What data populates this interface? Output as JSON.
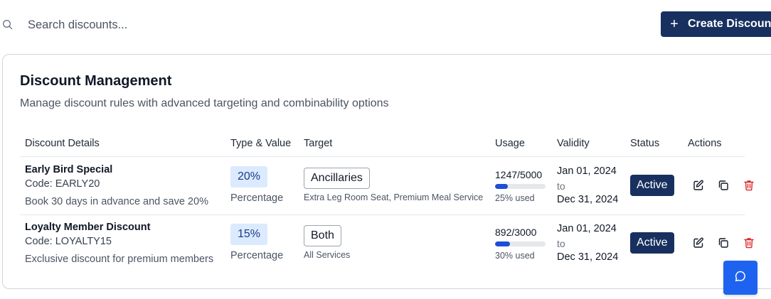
{
  "search": {
    "placeholder": "Search discounts..."
  },
  "create_button": {
    "label": "Create Discount"
  },
  "card": {
    "title": "Discount Management",
    "subtitle": "Manage discount rules with advanced targeting and combinability options"
  },
  "table": {
    "headers": [
      "Discount Details",
      "Type & Value",
      "Target",
      "Usage",
      "Validity",
      "Status",
      "Actions"
    ],
    "rows": [
      {
        "name": "Early Bird Special",
        "code": "Code: EARLY20",
        "description": "Book 30 days in advance and save 20%",
        "value": "20%",
        "type": "Percentage",
        "target": "Ancillaries",
        "target_detail": "Extra Leg Room Seat, Premium Meal Service",
        "usage": "1247/5000",
        "usage_fraction": 0.25,
        "usage_label": "25% used",
        "valid_from": "Jan 01, 2024",
        "valid_to_word": "to",
        "valid_until": "Dec 31, 2024",
        "status": "Active"
      },
      {
        "name": "Loyalty Member Discount",
        "code": "Code: LOYALTY15",
        "description": "Exclusive discount for premium members",
        "value": "15%",
        "type": "Percentage",
        "target": "Both",
        "target_detail": "All Services",
        "usage": "892/3000",
        "usage_fraction": 0.3,
        "usage_label": "30% used",
        "valid_from": "Jan 01, 2024",
        "valid_to_word": "to",
        "valid_until": "Dec 31, 2024",
        "status": "Active"
      }
    ]
  },
  "icons": {
    "search": "search-icon",
    "plus": "plus-icon",
    "edit": "edit-icon",
    "copy": "copy-icon",
    "delete": "trash-icon",
    "chat": "chat-icon"
  },
  "colors": {
    "primary": "#17305f",
    "accent": "#1d63f0",
    "badge_bg": "#dbeafe",
    "danger": "#dc2626"
  }
}
